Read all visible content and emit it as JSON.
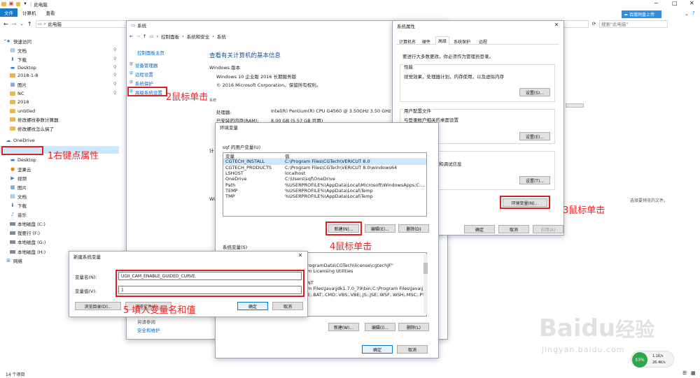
{
  "explorer": {
    "title": "此电脑",
    "ribbon_tabs": [
      "文件",
      "计算机",
      "查看"
    ],
    "address": "此电脑",
    "search_placeholder": "搜索\"此电脑\"",
    "status": "14 个项目",
    "preview_text": "选择要预览的文件。",
    "cloud_btn": "百度网盘上传",
    "nav": [
      {
        "label": "快速访问",
        "icon": "star-icon"
      },
      {
        "label": "文档",
        "icon": "document-icon",
        "pin": true
      },
      {
        "label": "下载",
        "icon": "download-icon",
        "pin": true
      },
      {
        "label": "Desktop",
        "icon": "desktop-icon",
        "pin": true
      },
      {
        "label": "2018-1-8",
        "icon": "folder-icon",
        "pin": true
      },
      {
        "label": "图片",
        "icon": "pictures-icon",
        "pin": true
      },
      {
        "label": "NC",
        "icon": "folder-icon",
        "pin": true
      },
      {
        "label": "2018",
        "icon": "folder-icon"
      },
      {
        "label": "untitled",
        "icon": "folder-icon"
      },
      {
        "label": "修改螺纹参数计算器",
        "icon": "folder-icon"
      },
      {
        "label": "修改螺纹怎么搞了",
        "icon": "folder-icon"
      },
      {
        "label": "OneDrive",
        "icon": "cloud-icon"
      },
      {
        "label": "此电脑",
        "icon": "pc-icon"
      },
      {
        "label": "Desktop",
        "icon": "desktop-icon"
      },
      {
        "label": "坚果云",
        "icon": "nut-icon"
      },
      {
        "label": "视频",
        "icon": "video-icon"
      },
      {
        "label": "图片",
        "icon": "pictures-icon"
      },
      {
        "label": "文档",
        "icon": "document-icon"
      },
      {
        "label": "下载",
        "icon": "download-icon"
      },
      {
        "label": "音乐",
        "icon": "music-icon"
      },
      {
        "label": "本地磁盘 (C:)",
        "icon": "drive-icon"
      },
      {
        "label": "我要行 (F:)",
        "icon": "drive-icon"
      },
      {
        "label": "本地磁盘 (G:)",
        "icon": "drive-icon"
      },
      {
        "label": "本地磁盘 (H:)",
        "icon": "drive-icon"
      },
      {
        "label": "网络",
        "icon": "network-icon"
      }
    ]
  },
  "system": {
    "title": "系统",
    "breadcrumb": [
      "控制面板",
      "系统和安全",
      "系统"
    ],
    "control_home": "控制面板主页",
    "links": [
      "设备管理器",
      "远程设置",
      "系统保护",
      "高级系统设置"
    ],
    "heading": "查看有关计算机的基本信息",
    "edition_label": "Windows 版本",
    "edition": "Windows 10 企业版 2016 长期服务版",
    "copyright": "© 2016 Microsoft Corporation。保留所有权利。",
    "processor_label": "处理器:",
    "processor": "Intel(R) Pentium(R) CPU G4560 @ 3.50GHz   3.50 GHz",
    "ram_label": "已安装的内存(RAM):",
    "ram": "8.00 GB (5.57 GB 可用)",
    "section_system": "系统",
    "see_also": "另请参阅",
    "security": "安全和维护",
    "cut_letters": [
      "计",
      "Wi"
    ]
  },
  "sysprops": {
    "title": "系统属性",
    "tabs": [
      "计算机名",
      "硬件",
      "高级",
      "系统保护",
      "远程"
    ],
    "note": "要进行大多数更改，你必须作为管理员登录。",
    "perf_title": "性能",
    "perf_desc": "视觉效果，处理器计划，内存使用，以及虚拟内存",
    "settings": "设置(S)...",
    "profile_title": "用户配置文件",
    "profile_desc": "与登录帐户相关的桌面设置",
    "settings_e": "设置(E)...",
    "startup_desc": "和调试信息",
    "settings_t": "设置(T)...",
    "env_btn": "环境变量(N)...",
    "ok": "确定",
    "cancel": "取消",
    "apply": "应用(A)"
  },
  "envvars": {
    "title": "环境变量",
    "user_label": "sqf 的用户变量(U)",
    "col_var": "变量",
    "col_val": "值",
    "user_vars": [
      [
        "CGTECH_INSTALL",
        "C:\\Program Files\\CGTech\\VERICUT 8.0"
      ],
      [
        "CGTECH_PRODUCTS",
        "C:\\Program Files\\CGTech\\VERICUT 8.0\\windows64"
      ],
      [
        "LSHOST",
        "localhost"
      ],
      [
        "OneDrive",
        "C:\\Users\\sqf\\OneDrive"
      ],
      [
        "Path",
        "%USERPROFILE%\\AppData\\Local\\Microsoft\\WindowsApps;C:..."
      ],
      [
        "TEMP",
        "%USERPROFILE%\\AppData\\Local\\Temp"
      ],
      [
        "TMP",
        "%USERPROFILE%\\AppData\\Local\\Temp"
      ]
    ],
    "new": "新建(N)...",
    "edit": "编辑(E)...",
    "delete": "删除(D)",
    "sys_label": "系统变量(S)",
    "sys_values": [
      "rogramData\\CGTech\\license\\cgtechJF\"",
      "m Licensing Utilities",
      "",
      "NT",
      "m Files\\Java\\jdk1.7.0_79\\bin;C:\\Program Files\\Java\\j...",
      "E;.BAT;.CMD;.VBS;.VBE;.JS;.JSE;.WSF;.WSH;.MSC;.PY;.P..."
    ],
    "new_w": "新建(W)...",
    "edit_i": "编辑(I)...",
    "delete_l": "删除(L)",
    "ok": "确定",
    "cancel": "取消"
  },
  "newvar": {
    "title": "新建系统变量",
    "name_label": "变量名(N):",
    "name_value": "UGII_CAM_ENABLE_GUIDED_CURVE",
    "value_label": "变量值(V):",
    "value_value": "1",
    "browse_dir": "浏览目录(D)...",
    "browse_file": "浏览文件(F)...",
    "ok": "确定",
    "cancel": "取消"
  },
  "annotations": [
    "1右键点属性",
    "2鼠标单击",
    "3鼠标单击",
    "4鼠标单击",
    "5 填入变量名和值"
  ],
  "widget": {
    "up": "1.1K/s",
    "down": "26.4K/s",
    "pct": "53%"
  },
  "watermark": {
    "brand": "Baidu",
    "cn": "经验",
    "url": "jingyan.baidu.com"
  },
  "colors": {
    "accent": "#0078d7",
    "annotation": "#ee2222",
    "selection": "#cce8ff"
  }
}
